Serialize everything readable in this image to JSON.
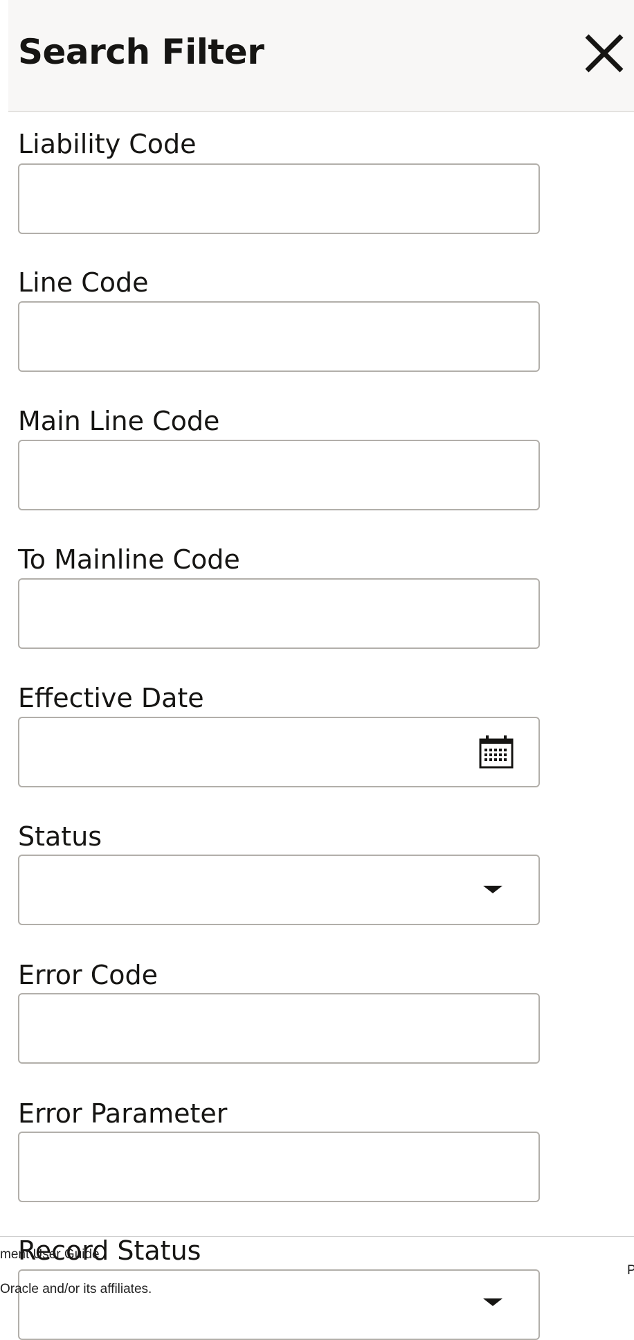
{
  "dialog": {
    "title": "Search Filter",
    "close_icon": "close-icon"
  },
  "fields": {
    "liability_code": {
      "label": "Liability Code",
      "value": ""
    },
    "line_code": {
      "label": "Line Code",
      "value": ""
    },
    "main_line_code": {
      "label": "Main Line Code",
      "value": ""
    },
    "to_mainline_code": {
      "label": "To Mainline Code",
      "value": ""
    },
    "effective_date": {
      "label": "Effective Date",
      "value": "",
      "icon": "calendar-icon"
    },
    "status": {
      "label": "Status",
      "value": "",
      "icon": "chevron-down-icon"
    },
    "error_code": {
      "label": "Error Code",
      "value": ""
    },
    "error_parameter": {
      "label": "Error Parameter",
      "value": ""
    },
    "record_status": {
      "label": "Record Status",
      "value": "",
      "icon": "chevron-down-icon"
    }
  },
  "footer": {
    "left_top": "ment User Guide",
    "left_bottom": "Oracle and/or its affiliates.",
    "right": "P"
  },
  "colors": {
    "header_bg": "#f8f7f6",
    "border": "#b2afaa",
    "text": "#161513"
  }
}
